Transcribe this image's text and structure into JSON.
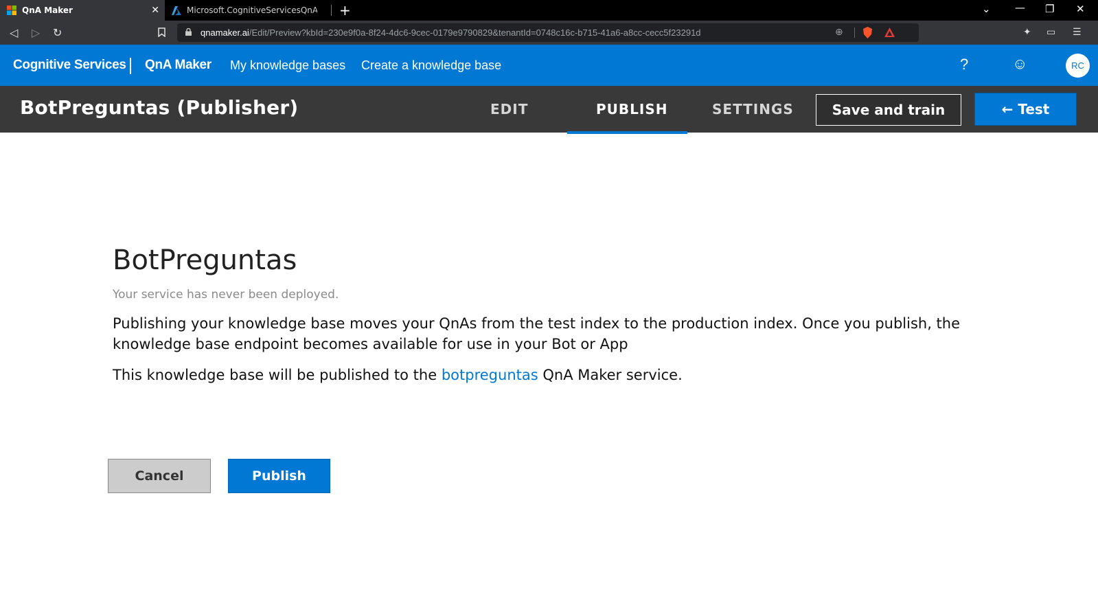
{
  "browser": {
    "tabs": [
      {
        "title": "QnA Maker",
        "active": true
      },
      {
        "title": "Microsoft.CognitiveServicesQnAMaker",
        "active": false
      }
    ],
    "url_host": "qnamaker.ai",
    "url_path": "/Edit/Preview?kbId=230e9f0a-8f24-4dc6-9cec-0179e9790829&tenantId=0748c16c-b715-41a6-a8cc-cecc5f23291d"
  },
  "topnav": {
    "brand": "Cognitive Services",
    "product": "QnA Maker",
    "links": [
      "My knowledge bases",
      "Create a knowledge base"
    ],
    "help": "?",
    "avatar": "RC",
    "color": "#0078d4"
  },
  "kb": {
    "title": "BotPreguntas (Publisher)",
    "tabs": [
      "EDIT",
      "PUBLISH",
      "SETTINGS"
    ],
    "active_tab": "PUBLISH",
    "save_label": "Save and train",
    "test_label": "← Test"
  },
  "main": {
    "service_name": "BotPreguntas",
    "deploy_note": "Your service has never been deployed.",
    "description": "Publishing your knowledge base moves your QnAs from the test index to the production index. Once you publish, the knowledge base endpoint becomes available for use in your Bot or App",
    "publish_prefix": "This knowledge base will be published to the",
    "publish_service": "botpreguntas",
    "publish_suffix": "QnA Maker service.",
    "cancel_label": "Cancel",
    "publish_label": "Publish"
  }
}
